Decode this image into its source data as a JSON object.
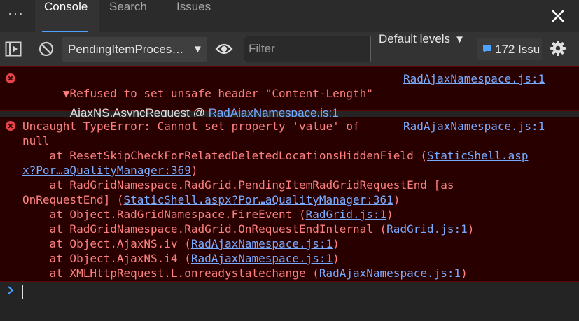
{
  "tabbar": {
    "tabs": [
      {
        "label": "Console",
        "active": true
      },
      {
        "label": "Search",
        "active": false
      },
      {
        "label": "Issues",
        "active": false
      }
    ],
    "more_icon": "more-dots-icon",
    "close_icon": "close-icon"
  },
  "toolbar": {
    "context": "PendingItemProces…",
    "filter_placeholder": "Filter",
    "levels_label": "Default levels",
    "issues_label": "172 Issu"
  },
  "messages": [
    {
      "text": "Refused to set unsafe header \"Content-Length\"",
      "source": "RadAjaxNamespace.js:1",
      "stack_fn": "AjaxNS.AsyncRequest",
      "stack_at": "@",
      "stack_link": "RadAjaxNamespace.js:1"
    },
    {
      "source": "RadAjaxNamespace.js:1",
      "lines": {
        "l1": "Uncaught TypeError: Cannot set property 'value' of",
        "l2": "null",
        "l3a": "    at ResetSkipCheckForRelatedDeletedLocationsHiddenField (",
        "l3link": "StaticShell.asp",
        "l4link": "x?Por…aQualityManager:369",
        "l4b": ")",
        "l5": "    at RadGridNamespace.RadGrid.PendingItemRadGridRequestEnd [as",
        "l6a": "OnRequestEnd] (",
        "l6link": "StaticShell.aspx?Por…aQualityManager:361",
        "l6b": ")",
        "l7a": "    at Object.RadGridNamespace.FireEvent (",
        "l7link": "RadGrid.js:1",
        "l7b": ")",
        "l8a": "    at RadGridNamespace.RadGrid.OnRequestEndInternal (",
        "l8link": "RadGrid.js:1",
        "l8b": ")",
        "l9a": "    at Object.AjaxNS.iv (",
        "l9link": "RadAjaxNamespace.js:1",
        "l9b": ")",
        "l10a": "    at Object.AjaxNS.i4 (",
        "l10link": "RadAjaxNamespace.js:1",
        "l10b": ")",
        "l11a": "    at XMLHttpRequest.L.onreadystatechange (",
        "l11link": "RadAjaxNamespace.js:1",
        "l11b": ")"
      }
    }
  ],
  "colors": {
    "error_text": "#ff8080",
    "error_bg": "#290000",
    "link": "#78aaff",
    "accent": "#4da3ff"
  }
}
